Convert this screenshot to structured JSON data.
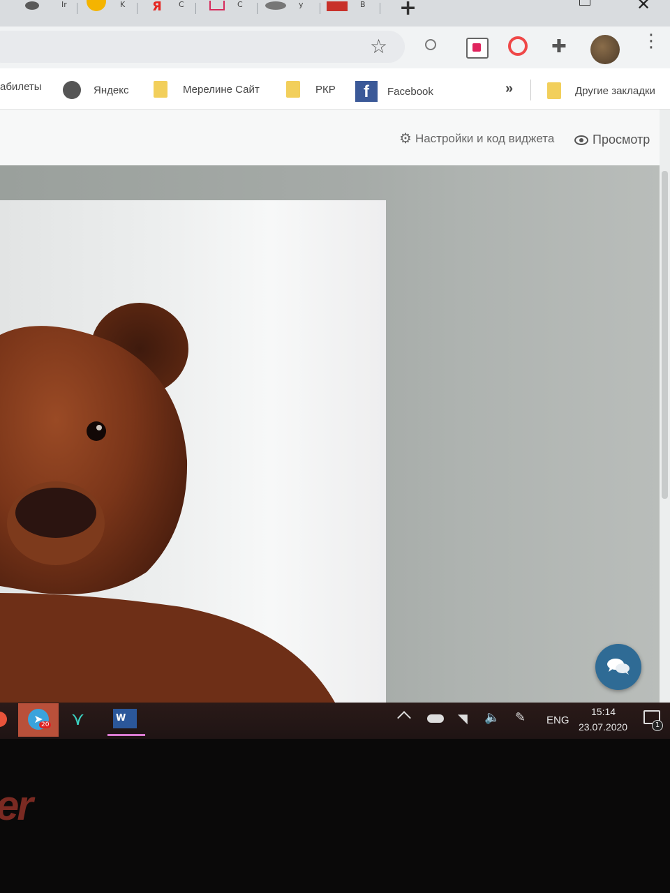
{
  "tabs": {
    "letters": [
      "Ir",
      "K",
      "C",
      "C",
      "y",
      "B"
    ]
  },
  "bookmarks": {
    "items": [
      {
        "label": "абилеты"
      },
      {
        "label": "Яндекс"
      },
      {
        "label": "Мерелине Сайт"
      },
      {
        "label": "РКР"
      },
      {
        "label": "Facebook"
      }
    ],
    "more_label": "»",
    "other_label": "Другие закладки"
  },
  "page_header": {
    "settings_label": "Настройки и код виджета",
    "preview_label": "Просмотр"
  },
  "taskbar": {
    "telegram_badge": "20",
    "word_letter": "W",
    "language": "ENG",
    "time": "15:14",
    "date": "23.07.2020",
    "notifications_count": "1"
  },
  "monitor": {
    "brand_partial": "er"
  },
  "colors": {
    "accent_chat": "#2f6b95",
    "folder": "#f2cf5b",
    "facebook": "#3b5998"
  }
}
